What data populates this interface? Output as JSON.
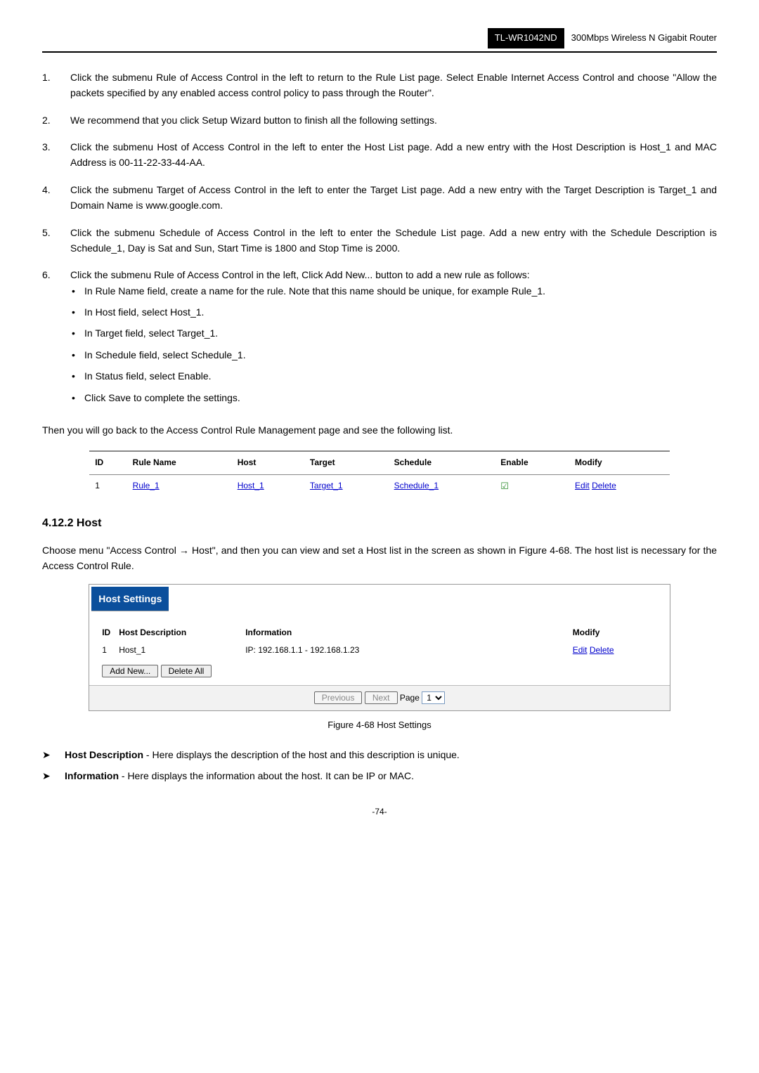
{
  "header": {
    "model": "TL-WR1042ND",
    "product": "300Mbps Wireless N Gigabit Router"
  },
  "steps": [
    {
      "num": "1.",
      "text": "Click the submenu Rule of Access Control in the left to return to the Rule List page. Select Enable Internet Access Control and choose \"Allow the packets specified by any enabled access control policy to pass through the Router\"."
    },
    {
      "num": "2.",
      "text": "We recommend that you click Setup Wizard button to finish all the following settings."
    },
    {
      "num": "3.",
      "text": "Click the submenu Host of Access Control in the left to enter the Host List page. Add a new entry with the Host Description is Host_1 and MAC Address is 00-11-22-33-44-AA."
    },
    {
      "num": "4.",
      "text": "Click the submenu Target of Access Control in the left to enter the Target List page. Add a new entry with the Target Description is Target_1 and Domain Name is www.google.com."
    },
    {
      "num": "5.",
      "text": "Click the submenu Schedule of Access Control in the left to enter the Schedule List page. Add a new entry with the Schedule Description is Schedule_1, Day is Sat and Sun, Start Time is 1800 and Stop Time is 2000."
    },
    {
      "num": "6.",
      "text": "Click the submenu Rule of Access Control in the left, Click Add New... button to add a new rule as follows:"
    }
  ],
  "substeps": [
    "In Rule Name field, create a name for the rule. Note that this name should be unique, for example Rule_1.",
    "In Host field, select Host_1.",
    "In Target field, select Target_1.",
    "In Schedule field, select Schedule_1.",
    "In Status field, select Enable.",
    "Click Save to complete the settings."
  ],
  "post_steps_line": "Then you will go back to the Access Control Rule Management page and see the following list.",
  "rule_table": {
    "headers": [
      "ID",
      "Rule Name",
      "Host",
      "Target",
      "Schedule",
      "Enable",
      "Modify"
    ],
    "rows": [
      {
        "id": "1",
        "rule_name": "Rule_1",
        "host": "Host_1",
        "target": "Target_1",
        "schedule": "Schedule_1",
        "enable_checked": true,
        "modify_edit": "Edit",
        "modify_delete": "Delete"
      }
    ]
  },
  "section": {
    "heading": "4.12.2  Host",
    "paragraph": "Choose menu \"Access Control → Host\", and then you can view and set a Host list in the screen as shown in Figure 4-68. The host list is necessary for the Access Control Rule."
  },
  "host_panel": {
    "title": "Host Settings",
    "headers": {
      "id": "ID",
      "desc": "Host Description",
      "info": "Information",
      "modify": "Modify"
    },
    "rows": [
      {
        "id": "1",
        "desc": "Host_1",
        "info": "IP: 192.168.1.1 - 192.168.1.23",
        "edit": "Edit",
        "delete": "Delete"
      }
    ],
    "buttons": {
      "add_new": "Add New...",
      "delete_all": "Delete All"
    },
    "pager": {
      "previous": "Previous",
      "next": "Next",
      "page_label": "Page",
      "page_value": "1"
    }
  },
  "figure_caption": "Figure 4-68    Host Settings",
  "legend": [
    {
      "term": "Host Description",
      "text": " - Here displays the description of the host and this description is unique."
    },
    {
      "term": "Information",
      "text": " - Here displays the information about the host. It can be IP or MAC."
    }
  ],
  "page_number": "-74-"
}
